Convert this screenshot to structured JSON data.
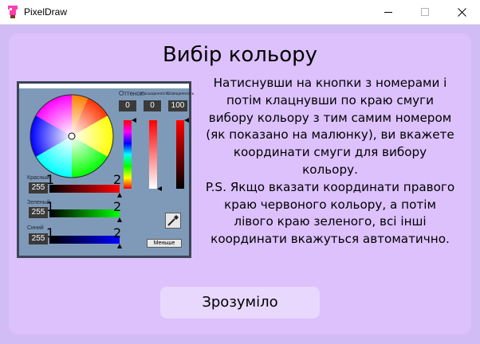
{
  "window": {
    "title": "PixelDraw"
  },
  "dialog": {
    "heading": "Вибір кольору",
    "paragraph": [
      "Натиснувши на кнопки з номерами і",
      "потім клацнувши по краю смуги",
      "вибору кольору з тим самим номером",
      "(як показано на малюнку), ви вкажете",
      "координати смуги для вибору",
      "кольору.",
      "P.S. Якщо вказати координати правого",
      "краю червоного кольору, а потім",
      "лівого краю зеленого, всі інші",
      "координати вкажуться автоматично."
    ],
    "ok_label": "Зрозуміло"
  },
  "picker_image": {
    "hue_label": "Оттенок:",
    "sat_label": "Насыщенность",
    "bri_label": "Освещенность",
    "hue_value": "0",
    "sat_value": "0",
    "bri_value": "100",
    "red_label": "Красный",
    "green_label": "Зеленый",
    "blue_label": "Синий",
    "red_value": "255",
    "green_value": "255",
    "blue_value": "255",
    "marker_1": "1",
    "marker_2": "2",
    "less_label": "Меньше"
  },
  "colors": {
    "window_bg": "#d2bcf6",
    "dialog_bg": "#dcc1fd",
    "button_bg": "#e8d8fe",
    "picker_bg": "#7f9ab8"
  }
}
